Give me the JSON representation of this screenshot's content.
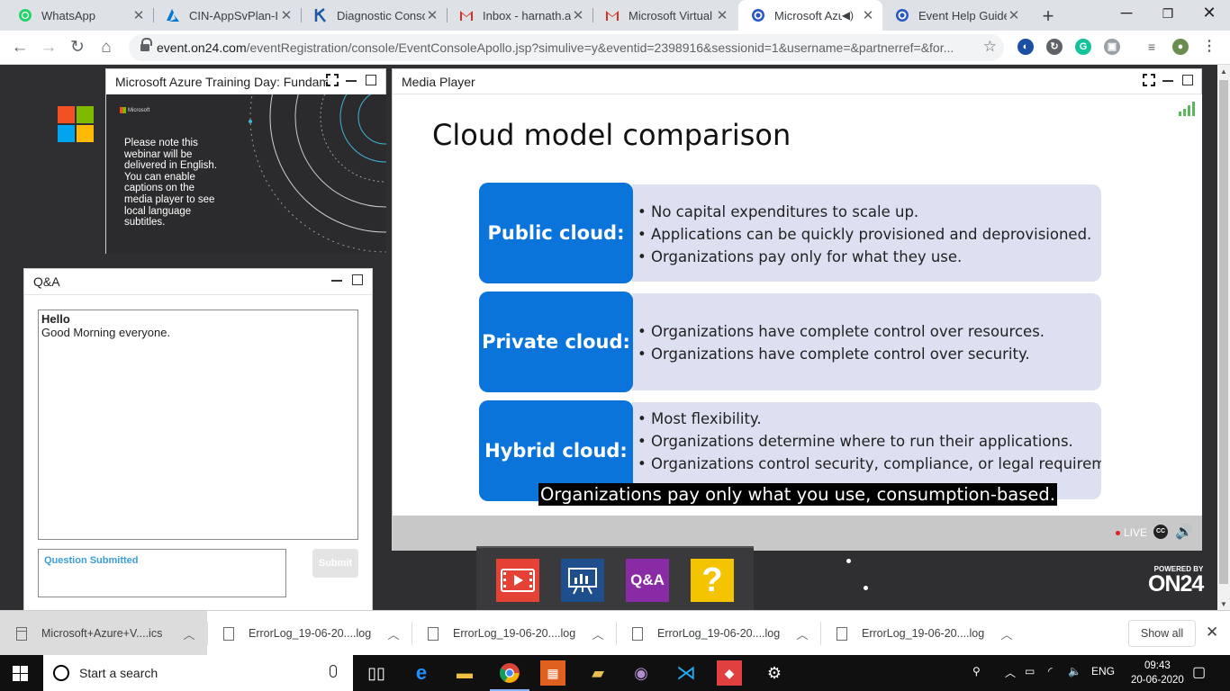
{
  "browser": {
    "tabs": [
      {
        "title": "WhatsApp",
        "icon": "whatsapp-icon",
        "color": "#25d366"
      },
      {
        "title": "CIN-AppSvPlan-IN",
        "icon": "azure-icon",
        "color": "#0078d4"
      },
      {
        "title": "Diagnostic Consol",
        "icon": "kudu-icon",
        "color": "#1e5aa8"
      },
      {
        "title": "Inbox - harnath.at",
        "icon": "gmail-icon",
        "color": "#d93025"
      },
      {
        "title": "Microsoft Virtual T",
        "icon": "gmail-icon",
        "color": "#d93025"
      },
      {
        "title": "Microsoft Azu",
        "icon": "on24-icon",
        "color": "#2b59c3",
        "active": true
      },
      {
        "title": "Event Help Guide",
        "icon": "on24-icon",
        "color": "#2b59c3"
      }
    ],
    "url_host": "event.on24.com",
    "url_path": "/eventRegistration/console/EventConsoleApollo.jsp?simulive=y&eventid=2398916&sessionid=1&username=&partnerref=&for..."
  },
  "page": {
    "slides_panel_title": "Microsoft Azure Training Day: Fundam",
    "slide_thumb_brand": "Microsoft",
    "slide_thumb_note": "Please note this webinar will be delivered in English. You can enable captions on the media player to see local language subtitles.",
    "qa": {
      "title": "Q&A",
      "message_title": "Hello",
      "message_body": "Good Morning everyone.",
      "input_status": "Question Submitted",
      "submit_label": "Submit"
    },
    "media": {
      "title": "Media Player",
      "slide_title": "Cloud model comparison",
      "rows": [
        {
          "label": "Public cloud:",
          "items": [
            "No capital expenditures to scale up.",
            "Applications can be quickly provisioned and deprovisioned.",
            "Organizations pay only for what they use."
          ]
        },
        {
          "label": "Private cloud:",
          "items": [
            "Organizations have complete control over resources.",
            "Organizations have complete control over security."
          ]
        },
        {
          "label": "Hybrid cloud:",
          "items": [
            "Most flexibility.",
            "Organizations determine where to run their applications.",
            "Organizations control security, compliance, or legal requirements."
          ]
        }
      ],
      "caption": "Organizations pay only what you use, consumption-based.",
      "live_label": "LIVE",
      "cc_label": "CC"
    },
    "dock": {
      "qa_label": "Q&A",
      "help_label": "?"
    },
    "powered_by": "POWERED BY",
    "powered_brand": "ON24"
  },
  "downloads": {
    "items": [
      "Microsoft+Azure+V....ics",
      "ErrorLog_19-06-20....log",
      "ErrorLog_19-06-20....log",
      "ErrorLog_19-06-20....log",
      "ErrorLog_19-06-20....log"
    ],
    "show_all": "Show all"
  },
  "taskbar": {
    "search_placeholder": "Start a search",
    "language": "ENG",
    "time": "09:43",
    "date": "20-06-2020"
  }
}
